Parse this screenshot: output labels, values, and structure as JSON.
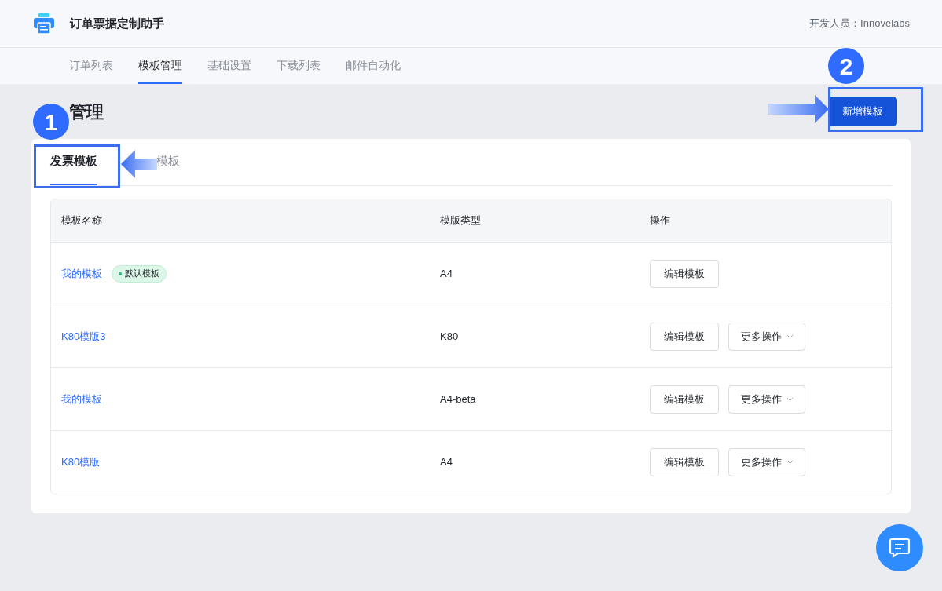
{
  "app": {
    "title": "订单票据定制助手",
    "developer": "开发人员：Innovelabs"
  },
  "nav": [
    {
      "label": "订单列表",
      "selected": false
    },
    {
      "label": "模板管理",
      "selected": true
    },
    {
      "label": "基础设置",
      "selected": false
    },
    {
      "label": "下载列表",
      "selected": false
    },
    {
      "label": "邮件自动化",
      "selected": false
    }
  ],
  "page_title": "管理",
  "add_button": "新增模板",
  "tabs": [
    {
      "label": "发票模板",
      "selected": true
    },
    {
      "label": "模板",
      "selected": false
    }
  ],
  "table": {
    "columns": [
      "模板名称",
      "模版类型",
      "操作"
    ],
    "rows": [
      {
        "name": "我的模板",
        "badge": "默认模板",
        "type": "A4",
        "edit": "编辑模板"
      },
      {
        "name": "K80模版3",
        "type": "K80",
        "edit": "编辑模板",
        "more": "更多操作"
      },
      {
        "name": "我的模板",
        "type": "A4-beta",
        "edit": "编辑模板",
        "more": "更多操作"
      },
      {
        "name": "K80模版",
        "type": "A4",
        "edit": "编辑模板",
        "more": "更多操作"
      }
    ]
  },
  "annotations": [
    {
      "label": "1"
    },
    {
      "label": "2"
    }
  ]
}
